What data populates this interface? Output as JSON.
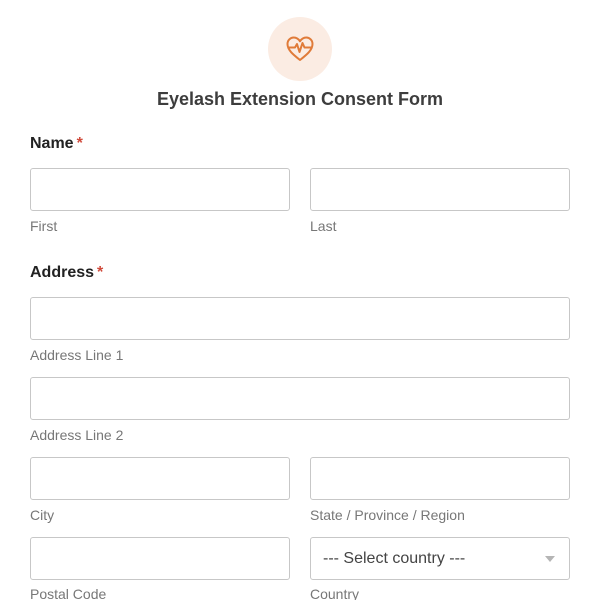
{
  "header": {
    "icon": "heart-pulse-icon",
    "icon_circle_color": "#fbece3",
    "icon_color": "#e07b39",
    "title": "Eyelash Extension Consent Form"
  },
  "name_section": {
    "label": "Name",
    "required_marker": "*",
    "first_value": "",
    "first_sublabel": "First",
    "last_value": "",
    "last_sublabel": "Last"
  },
  "address_section": {
    "label": "Address",
    "required_marker": "*",
    "line1_value": "",
    "line1_sublabel": "Address Line 1",
    "line2_value": "",
    "line2_sublabel": "Address Line 2",
    "city_value": "",
    "city_sublabel": "City",
    "state_value": "",
    "state_sublabel": "State / Province / Region",
    "postal_value": "",
    "postal_sublabel": "Postal Code",
    "country_selected": "--- Select country ---",
    "country_sublabel": "Country"
  },
  "colors": {
    "required": "#d0493a",
    "border": "#c7c7c7",
    "sublabel": "#777777"
  }
}
